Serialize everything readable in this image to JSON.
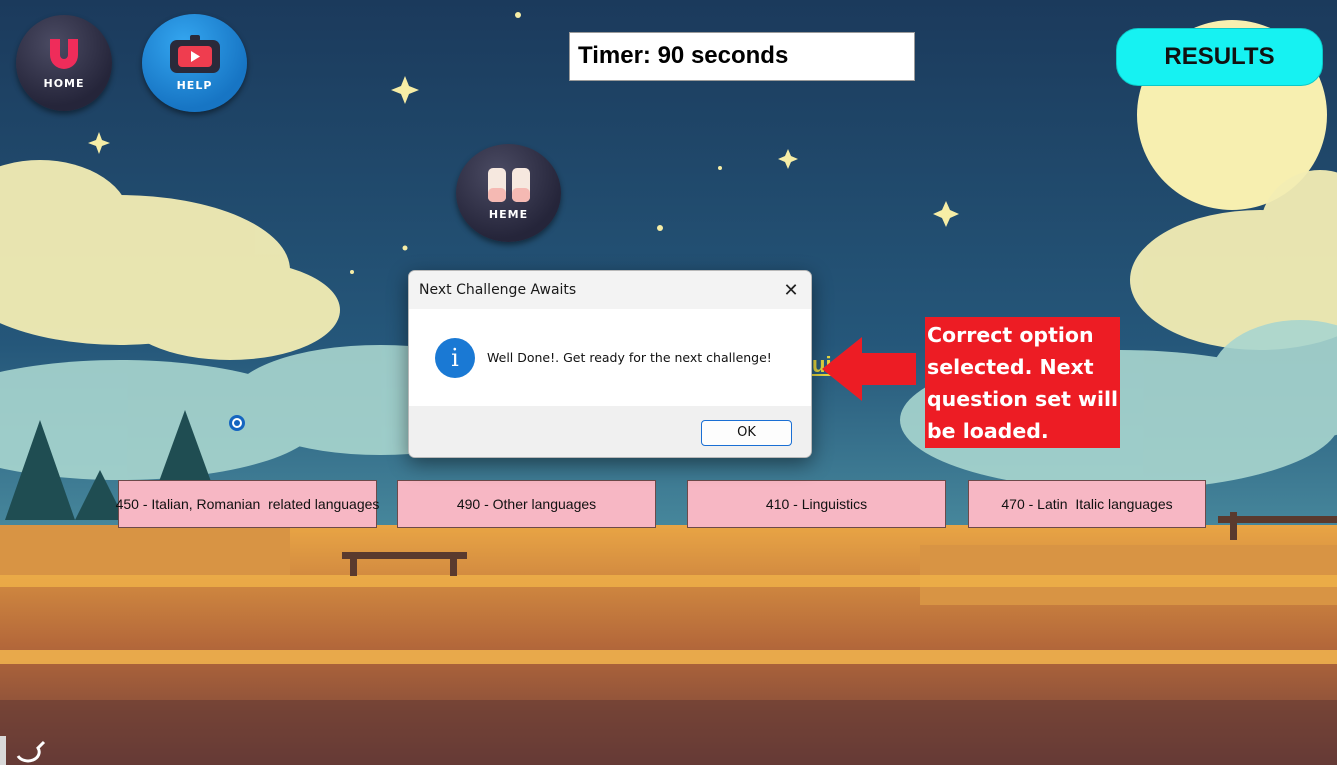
{
  "header": {
    "home_label": "HOME",
    "help_label": "HELP",
    "theme_label": "HEME",
    "timer_text": "Timer: 90 seconds",
    "results_label": "RESULTS"
  },
  "question": {
    "visible_fragment": "ui"
  },
  "options": [
    {
      "label": "450 - Italian, Romanian  related languages"
    },
    {
      "label": "490 - Other languages"
    },
    {
      "label": "410 - Linguistics"
    },
    {
      "label": "470 - Latin  Italic languages"
    }
  ],
  "dialog": {
    "title": "Next Challenge Awaits",
    "close_glyph": "✕",
    "icon_glyph": "i",
    "message": "Well Done!. Get ready for the next challenge!",
    "ok_label": "OK"
  },
  "annotation": {
    "text": "Correct option\nselected. Next\nquestion set will\nbe loaded."
  },
  "colors": {
    "results_button": "#16f2f2",
    "option_fill": "#f7b7c4",
    "annotation": "#ed1c24",
    "info_icon": "#1a79d4"
  }
}
